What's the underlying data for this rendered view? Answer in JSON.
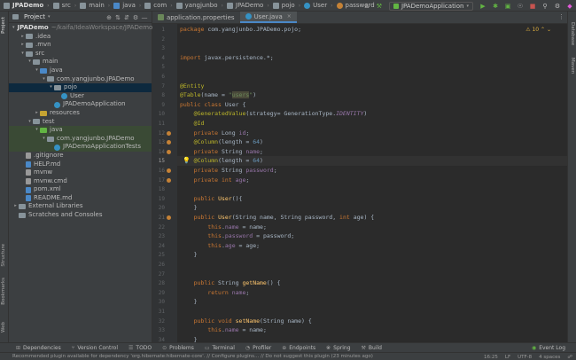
{
  "breadcrumbs": [
    {
      "label": "JPADemo",
      "icon": "folder-icon",
      "color": "#87939a"
    },
    {
      "label": "src",
      "icon": "folder-icon",
      "color": "#87939a"
    },
    {
      "label": "main",
      "icon": "folder-icon",
      "color": "#87939a"
    },
    {
      "label": "java",
      "icon": "folder-icon",
      "color": "#4a88c7"
    },
    {
      "label": "com",
      "icon": "folder-icon",
      "color": "#87939a"
    },
    {
      "label": "yangjunbo",
      "icon": "folder-icon",
      "color": "#87939a"
    },
    {
      "label": "JPADemo",
      "icon": "folder-icon",
      "color": "#87939a"
    },
    {
      "label": "pojo",
      "icon": "folder-icon",
      "color": "#87939a"
    },
    {
      "label": "User",
      "icon": "class-icon",
      "color": "#3592c4"
    },
    {
      "label": "password",
      "icon": "field-icon",
      "color": "#c58236"
    }
  ],
  "run_config": "JPADemoApplication",
  "project_panel": {
    "title": "Project",
    "tree": [
      {
        "label": "JPADemo",
        "extra": "~/kaifa/IdeaWorkspace/JPADemo",
        "depth": 0,
        "arrow": "▾",
        "kind": "folder",
        "color": "#87939a",
        "bold": true
      },
      {
        "label": ".idea",
        "depth": 1,
        "arrow": "▸",
        "kind": "folder",
        "color": "#87939a"
      },
      {
        "label": ".mvn",
        "depth": 1,
        "arrow": "▸",
        "kind": "folder",
        "color": "#87939a"
      },
      {
        "label": "src",
        "depth": 1,
        "arrow": "▾",
        "kind": "folder",
        "color": "#87939a"
      },
      {
        "label": "main",
        "depth": 2,
        "arrow": "▾",
        "kind": "folder",
        "color": "#87939a"
      },
      {
        "label": "java",
        "depth": 3,
        "arrow": "▾",
        "kind": "folder",
        "color": "#4a88c7"
      },
      {
        "label": "com.yangjunbo.JPADemo",
        "depth": 4,
        "arrow": "▾",
        "kind": "folder",
        "color": "#87939a"
      },
      {
        "label": "pojo",
        "depth": 5,
        "arrow": "▾",
        "kind": "folder",
        "color": "#87939a",
        "selected": true
      },
      {
        "label": "User",
        "depth": 6,
        "arrow": "",
        "kind": "class",
        "color": "#3592c4"
      },
      {
        "label": "JPADemoApplication",
        "depth": 5,
        "arrow": "",
        "kind": "class",
        "color": "#3592c4"
      },
      {
        "label": "resources",
        "depth": 3,
        "arrow": "▸",
        "kind": "folder",
        "color": "#c5a332"
      },
      {
        "label": "test",
        "depth": 2,
        "arrow": "▾",
        "kind": "folder",
        "color": "#87939a"
      },
      {
        "label": "java",
        "depth": 3,
        "arrow": "▾",
        "kind": "folder",
        "color": "#62b543",
        "hl": true
      },
      {
        "label": "com.yangjunbo.JPADemo",
        "depth": 4,
        "arrow": "▾",
        "kind": "folder",
        "color": "#87939a",
        "hl": true
      },
      {
        "label": "JPADemoApplicationTests",
        "depth": 5,
        "arrow": "",
        "kind": "class",
        "color": "#3592c4",
        "hl": true
      },
      {
        "label": ".gitignore",
        "depth": 1,
        "arrow": "",
        "kind": "file",
        "color": "#999999"
      },
      {
        "label": "HELP.md",
        "depth": 1,
        "arrow": "",
        "kind": "file",
        "color": "#4a88c7"
      },
      {
        "label": "mvnw",
        "depth": 1,
        "arrow": "",
        "kind": "file",
        "color": "#999999"
      },
      {
        "label": "mvnw.cmd",
        "depth": 1,
        "arrow": "",
        "kind": "file",
        "color": "#999999"
      },
      {
        "label": "pom.xml",
        "depth": 1,
        "arrow": "",
        "kind": "file",
        "color": "#4a88c7"
      },
      {
        "label": "README.md",
        "depth": 1,
        "arrow": "",
        "kind": "file",
        "color": "#4a88c7"
      },
      {
        "label": "External Libraries",
        "depth": 0,
        "arrow": "▸",
        "kind": "lib",
        "color": "#87939a"
      },
      {
        "label": "Scratches and Consoles",
        "depth": 0,
        "arrow": "",
        "kind": "scratch",
        "color": "#87939a"
      }
    ]
  },
  "editor_tabs": [
    {
      "label": "application.properties",
      "icon": "properties-icon",
      "color": "#6a8759",
      "active": false
    },
    {
      "label": "User.java",
      "icon": "class-icon",
      "color": "#3592c4",
      "active": true
    }
  ],
  "inspection_count": "10",
  "current_line": 15,
  "code_lines": [
    {
      "n": 1,
      "html": "<span class=\"kw\">package</span> com.yangjunbo.JPADemo.pojo;"
    },
    {
      "n": 2,
      "html": ""
    },
    {
      "n": 3,
      "html": ""
    },
    {
      "n": 4,
      "html": "<span class=\"kw\">import</span> javax.persistence.*;"
    },
    {
      "n": 5,
      "html": ""
    },
    {
      "n": 6,
      "html": ""
    },
    {
      "n": 7,
      "html": "<span class=\"an\">@Entity</span>"
    },
    {
      "n": 8,
      "html": "<span class=\"an\">@Table</span>(name = <span class=\"st\">\"<span class=\"sel\">users</span>\"</span>)"
    },
    {
      "n": 9,
      "html": "<span class=\"kw\">public class</span> User {"
    },
    {
      "n": 10,
      "html": "    <span class=\"an\">@GeneratedValue</span>(strategy= GenerationType.<span class=\"it\">IDENTITY</span>)"
    },
    {
      "n": 11,
      "html": "    <span class=\"an\">@Id</span>"
    },
    {
      "n": 12,
      "html": "    <span class=\"kw\">private</span> Long <span class=\"fd\">id</span>;"
    },
    {
      "n": 13,
      "html": "    <span class=\"an\">@Column</span>(length = <span class=\"num\">64</span>)"
    },
    {
      "n": 14,
      "html": "    <span class=\"kw\">private</span> String <span class=\"fd\">name</span>;"
    },
    {
      "n": 15,
      "html": "    <span class=\"an\">@Column</span>(length = <span class=\"num\">64</span>)"
    },
    {
      "n": 16,
      "html": "    <span class=\"kw\">private</span> String <span class=\"fd\">password</span>;"
    },
    {
      "n": 17,
      "html": "    <span class=\"kw\">private int</span> <span class=\"fd\">age</span>;"
    },
    {
      "n": 18,
      "html": ""
    },
    {
      "n": 19,
      "html": "    <span class=\"kw\">public</span> <span class=\"fn\">User</span>(){"
    },
    {
      "n": 20,
      "html": "    }"
    },
    {
      "n": 21,
      "html": "    <span class=\"kw\">public</span> <span class=\"fn\">User</span>(String name, String password, <span class=\"kw\">int</span> age) {"
    },
    {
      "n": 22,
      "html": "        <span class=\"kw\">this</span>.<span class=\"fd\">name</span> = name;"
    },
    {
      "n": 23,
      "html": "        <span class=\"kw\">this</span>.<span class=\"fd\">password</span> = password;"
    },
    {
      "n": 24,
      "html": "        <span class=\"kw\">this</span>.<span class=\"fd\">age</span> = age;"
    },
    {
      "n": 25,
      "html": "    }"
    },
    {
      "n": 26,
      "html": ""
    },
    {
      "n": 27,
      "html": ""
    },
    {
      "n": 28,
      "html": "    <span class=\"kw\">public</span> String <span class=\"fn\">getName</span>() {"
    },
    {
      "n": 29,
      "html": "        <span class=\"kw\">return</span> <span class=\"fd\">name</span>;"
    },
    {
      "n": 30,
      "html": "    }"
    },
    {
      "n": 31,
      "html": ""
    },
    {
      "n": 32,
      "html": "    <span class=\"kw\">public void</span> <span class=\"fn\">setName</span>(String name) {"
    },
    {
      "n": 33,
      "html": "        <span class=\"kw\">this</span>.<span class=\"fd\">name</span> = name;"
    },
    {
      "n": 34,
      "html": "    }"
    }
  ],
  "gutter_marks": [
    12,
    13,
    14,
    16,
    17,
    21
  ],
  "bulb_line": 15,
  "left_tabs": [
    "Project",
    "Structure",
    "Bookmarks",
    "Web"
  ],
  "right_tabs": [
    "Database",
    "Maven"
  ],
  "tool_windows": [
    {
      "label": "Dependencies",
      "icon": "dependencies-icon"
    },
    {
      "label": "Version Control",
      "icon": "vcs-icon"
    },
    {
      "label": "TODO",
      "icon": "todo-icon"
    },
    {
      "label": "Problems",
      "icon": "problems-icon"
    },
    {
      "label": "Terminal",
      "icon": "terminal-icon"
    },
    {
      "label": "Profiler",
      "icon": "profiler-icon"
    },
    {
      "label": "Endpoints",
      "icon": "endpoints-icon"
    },
    {
      "label": "Spring",
      "icon": "spring-icon"
    },
    {
      "label": "Build",
      "icon": "build-icon"
    }
  ],
  "event_log": "Event Log",
  "status": {
    "message": "Recommended plugin available for dependency 'org.hibernate:hibernate-core'. // Configure plugins... // Do not suggest this plugin (23 minutes ago)",
    "position": "16:25",
    "line_sep": "LF",
    "encoding": "UTF-8",
    "indent": "4 spaces"
  }
}
